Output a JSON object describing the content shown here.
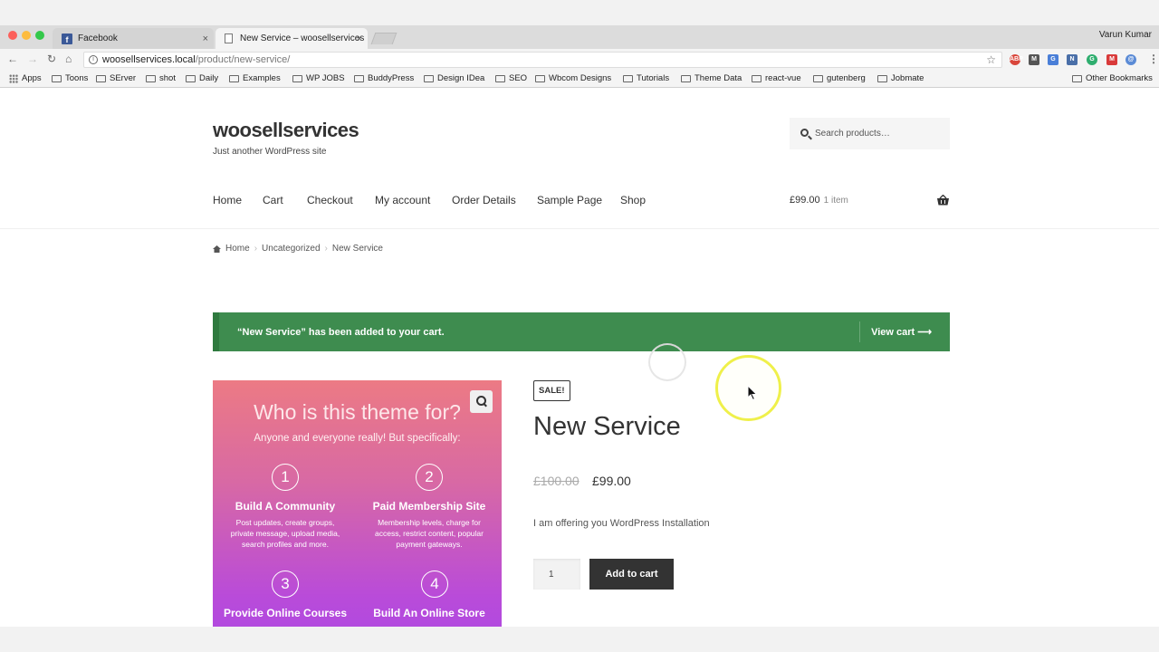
{
  "browser": {
    "tabs": [
      {
        "label": "Facebook"
      },
      {
        "label": "New Service – woosellservices"
      }
    ],
    "user": "Varun Kumar",
    "url_host": "woosellservices.local",
    "url_path": "/product/new-service/",
    "bookmarks": [
      "Apps",
      "Toons",
      "SErver",
      "shot",
      "Daily",
      "Examples",
      "WP JOBS",
      "BuddyPress",
      "Design IDea",
      "SEO",
      "Wbcom Designs",
      "Tutorials",
      "Theme Data",
      "react-vue",
      "gutenberg",
      "Jobmate"
    ],
    "other_bookmarks": "Other Bookmarks",
    "extensions": [
      {
        "name": "abp-icon",
        "color": "#d9463b"
      },
      {
        "name": "gmail-icon",
        "color": "#555555"
      },
      {
        "name": "translate-icon",
        "color": "#4a7fd8"
      },
      {
        "name": "new-ext-icon",
        "color": "#4a6fa8"
      },
      {
        "name": "grammarly-icon",
        "color": "#2fae6f"
      },
      {
        "name": "mail-ext-icon",
        "color": "#d93a3a"
      },
      {
        "name": "at-ext-icon",
        "color": "#5b8bd6"
      }
    ]
  },
  "site": {
    "title": "woosellservices",
    "tagline": "Just another WordPress site",
    "search_placeholder": "Search products…",
    "menu": [
      "Home",
      "Cart",
      "Checkout",
      "My account",
      "Order Details",
      "Sample Page",
      "Shop"
    ],
    "cart_total": "£99.00",
    "cart_count": "1 item"
  },
  "breadcrumb": [
    "Home",
    "Uncategorized",
    "New Service"
  ],
  "notice": {
    "message": "“New Service” has been added to your cart.",
    "link": "View cart ⟶",
    "color": "#3e8c4f"
  },
  "product_image": {
    "heading": "Who is this theme for?",
    "subheading": "Anyone and everyone really! But specifically:",
    "features": [
      {
        "num": "1",
        "title": "Build A Community",
        "desc": "Post updates, create groups, private message, upload media, search profiles and more."
      },
      {
        "num": "2",
        "title": "Paid Membership Site",
        "desc": "Membership levels, charge for access, restrict content, popular payment gateways."
      },
      {
        "num": "3",
        "title": "Provide Online Courses",
        "desc": ""
      },
      {
        "num": "4",
        "title": "Build An Online Store",
        "desc": ""
      }
    ]
  },
  "product": {
    "badge": "SALE!",
    "title": "New Service",
    "old_price": "£100.00",
    "price": "£99.00",
    "short_description": "I am offering you WordPress Installation",
    "quantity": "1",
    "add_to_cart": "Add to cart"
  }
}
